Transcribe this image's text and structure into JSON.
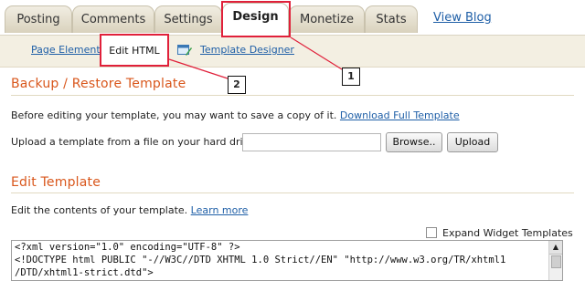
{
  "tabs": [
    {
      "label": "Posting"
    },
    {
      "label": "Comments"
    },
    {
      "label": "Settings"
    },
    {
      "label": "Design"
    },
    {
      "label": "Monetize"
    },
    {
      "label": "Stats"
    }
  ],
  "view_blog": "View Blog",
  "subtabs": {
    "page_elements": "Page Elements",
    "edit_html": "Edit HTML",
    "template_designer": "Template Designer"
  },
  "annotations": {
    "one": "1",
    "two": "2"
  },
  "backup": {
    "title": "Backup / Restore Template",
    "intro": "Before editing your template, you may want to save a copy of it.",
    "download_link": "Download Full Template",
    "upload_label": "Upload a template from a file on your hard drive:",
    "browse": "Browse..",
    "upload": "Upload"
  },
  "edit": {
    "title": "Edit Template",
    "intro": "Edit the contents of your template.",
    "learn_more": "Learn more",
    "expand_label": "Expand Widget Templates",
    "code_lines": [
      "<?xml version=\"1.0\" encoding=\"UTF-8\" ?>",
      "<!DOCTYPE html PUBLIC \"-//W3C//DTD XHTML 1.0 Strict//EN\" \"http://www.w3.org/TR/xhtml1",
      "/DTD/xhtml1-strict.dtd\">"
    ]
  },
  "colors": {
    "accent": "#d9571c",
    "link": "#1f5fa7",
    "highlight": "#e0203a"
  }
}
